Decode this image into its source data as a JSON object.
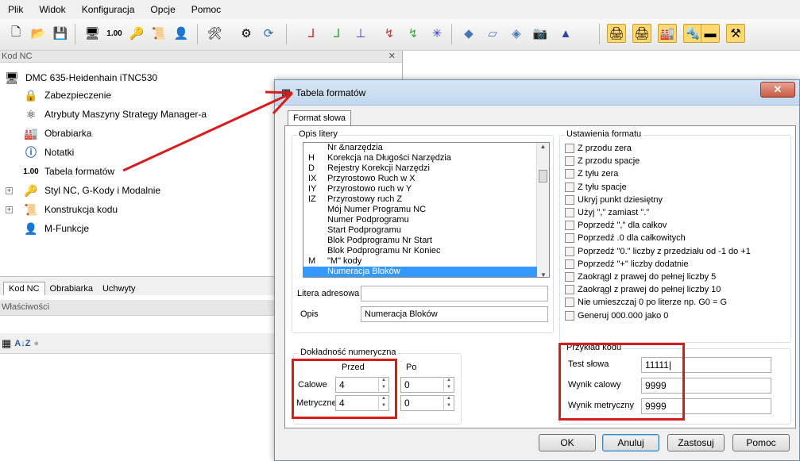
{
  "menu": [
    "Plik",
    "Widok",
    "Konfiguracja",
    "Opcje",
    "Pomoc"
  ],
  "left_panel": {
    "title": "Kod NC",
    "root": "DMC 635-Heidenhain iTNC530",
    "items": [
      "Zabezpieczenie",
      "Atrybuty Maszyny Strategy Manager-a",
      "Obrabiarka",
      "Notatki",
      "Tabela formatów",
      "Styl NC, G-Kody i Modalnie",
      "Konstrukcja kodu",
      "M-Funkcje"
    ],
    "tabs": [
      "Kod NC",
      "Obrabiarka",
      "Uchwyty"
    ],
    "properties_title": "Właściwości"
  },
  "dialog": {
    "title": "Tabela formatów",
    "tab": "Format słowa",
    "opis_litery_label": "Opis litery",
    "list": [
      {
        "k": "",
        "v": "Nr &narzędzia"
      },
      {
        "k": "H",
        "v": "Korekcja na Długości Narzędzia"
      },
      {
        "k": "D",
        "v": "Rejestry Korekcji Narzędzi"
      },
      {
        "k": "IX",
        "v": "Przyrostowo Ruch w X"
      },
      {
        "k": "IY",
        "v": "Przyrostowo ruch w Y"
      },
      {
        "k": "IZ",
        "v": "Przyrostowy ruch Z"
      },
      {
        "k": "",
        "v": "Mój Numer Programu NC"
      },
      {
        "k": "",
        "v": "Numer Podprogramu"
      },
      {
        "k": "",
        "v": "Start Podprogramu"
      },
      {
        "k": "",
        "v": "Blok Podprogramu Nr Start"
      },
      {
        "k": "",
        "v": "Blok Podprogramu Nr Koniec"
      },
      {
        "k": "M",
        "v": "\"M\" kody"
      },
      {
        "k": "",
        "v": "Numeracja Bloków"
      }
    ],
    "litera_label": "Litera adresowa",
    "litera_value": "",
    "opis_label": "Opis",
    "opis_value": "Numeracja Bloków",
    "ustawienia_label": "Ustawienia formatu",
    "checkboxes": [
      "Z przodu zera",
      "Z przodu spacje",
      "Z tyłu zera",
      "Z tyłu spacje",
      "Ukryj punkt dziesiętny",
      "Użyj \",\" zamiast \".\"",
      "Poprzedź \",\" dla całkov",
      "Poprzedź .0 dla całkowitych",
      "Poprzedź \"0.\" liczby z przedziału od -1 do +1",
      "Poprzedź \"+\" liczby dodatnie",
      "Zaokrągl z prawej do pełnej liczby 5",
      "Zaokrągl z prawej do pełnej liczby 10",
      "Nie umieszczaj 0 po literze np. G0 = G",
      "Generuj 000.000 jako 0"
    ],
    "dokladnosc_label": "Dokładność numeryczna",
    "przed_label": "Przed",
    "po_label": "Po",
    "calowe_label": "Calowe",
    "metryczne_label": "Metryczne",
    "calowe_przed": "4",
    "calowe_po": "0",
    "metryczne_przed": "4",
    "metryczne_po": "0",
    "przyklad_label": "Przykład kodu",
    "test_label": "Test słowa",
    "test_value": "11111",
    "wynik_calowy_label": "Wynik calowy",
    "wynik_calowy_value": "9999",
    "wynik_metryczny_label": "Wynik metryczny",
    "wynik_metryczny_value": "9999",
    "buttons": {
      "ok": "OK",
      "anuluj": "Anuluj",
      "zastosuj": "Zastosuj",
      "pomoc": "Pomoc"
    }
  },
  "colors": {
    "highlight": "#3399ff",
    "annotation_red": "#d81c1c"
  }
}
